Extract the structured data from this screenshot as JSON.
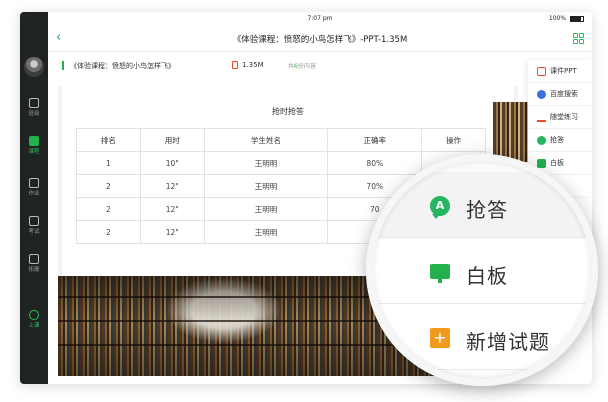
{
  "status_bar": {
    "time": "7:07 pm",
    "battery": "100%"
  },
  "header": {
    "back_icon": "chevron-left-icon",
    "title": "《体验课程：愤怒的小鸟怎样飞》-PPT-1.35M",
    "menu_icon": "grid-icon"
  },
  "file_info": {
    "name": "《体验课程：愤怒的小鸟怎样飞》",
    "size": "1.35M",
    "count_prefix": "共",
    "count": "6",
    "count_suffix": "份内容"
  },
  "sidebar": {
    "items": [
      {
        "label": "班级",
        "icon": "home-icon"
      },
      {
        "label": "课程",
        "icon": "book-icon",
        "active": true
      },
      {
        "label": "作业",
        "icon": "clipboard-icon"
      },
      {
        "label": "考试",
        "icon": "exam-icon"
      },
      {
        "label": "拓展",
        "icon": "bookmark-icon"
      },
      {
        "label": "上课",
        "icon": "clock-icon"
      }
    ]
  },
  "panel": {
    "title": "抢时抢答",
    "columns": [
      "排名",
      "用时",
      "学生姓名",
      "正确率",
      "操作"
    ],
    "rows": [
      [
        "1",
        "10\"",
        "王明明",
        "80%",
        ""
      ],
      [
        "2",
        "12\"",
        "王明明",
        "70%",
        ""
      ],
      [
        "2",
        "12\"",
        "王明明",
        "70",
        ""
      ],
      [
        "2",
        "12\"",
        "王明明",
        "",
        ""
      ]
    ]
  },
  "tool_menu": {
    "items": [
      {
        "label": "课件PPT",
        "icon": "ppt-icon",
        "color": "#ef4a24"
      },
      {
        "label": "百度搜索",
        "icon": "baidu-paw-icon",
        "color": "#3a6fe0"
      },
      {
        "label": "随堂练习",
        "icon": "practice-icon",
        "color": "#ef4a24"
      },
      {
        "label": "抢答",
        "icon": "quick-answer-icon",
        "color": "#27b463"
      },
      {
        "label": "白板",
        "icon": "whiteboard-icon",
        "color": "#22b14c"
      }
    ]
  },
  "magnifier": {
    "items": [
      {
        "label": "抢答",
        "icon": "quick-answer-icon",
        "glyph": "A"
      },
      {
        "label": "白板",
        "icon": "whiteboard-icon"
      },
      {
        "label": "新增试题",
        "icon": "add-question-icon",
        "glyph": "+"
      }
    ]
  },
  "colors": {
    "accent": "#22b14c",
    "sidebar_bg": "#1f2321",
    "file_icon": "#ef4a24",
    "add_icon": "#f29a1f"
  }
}
